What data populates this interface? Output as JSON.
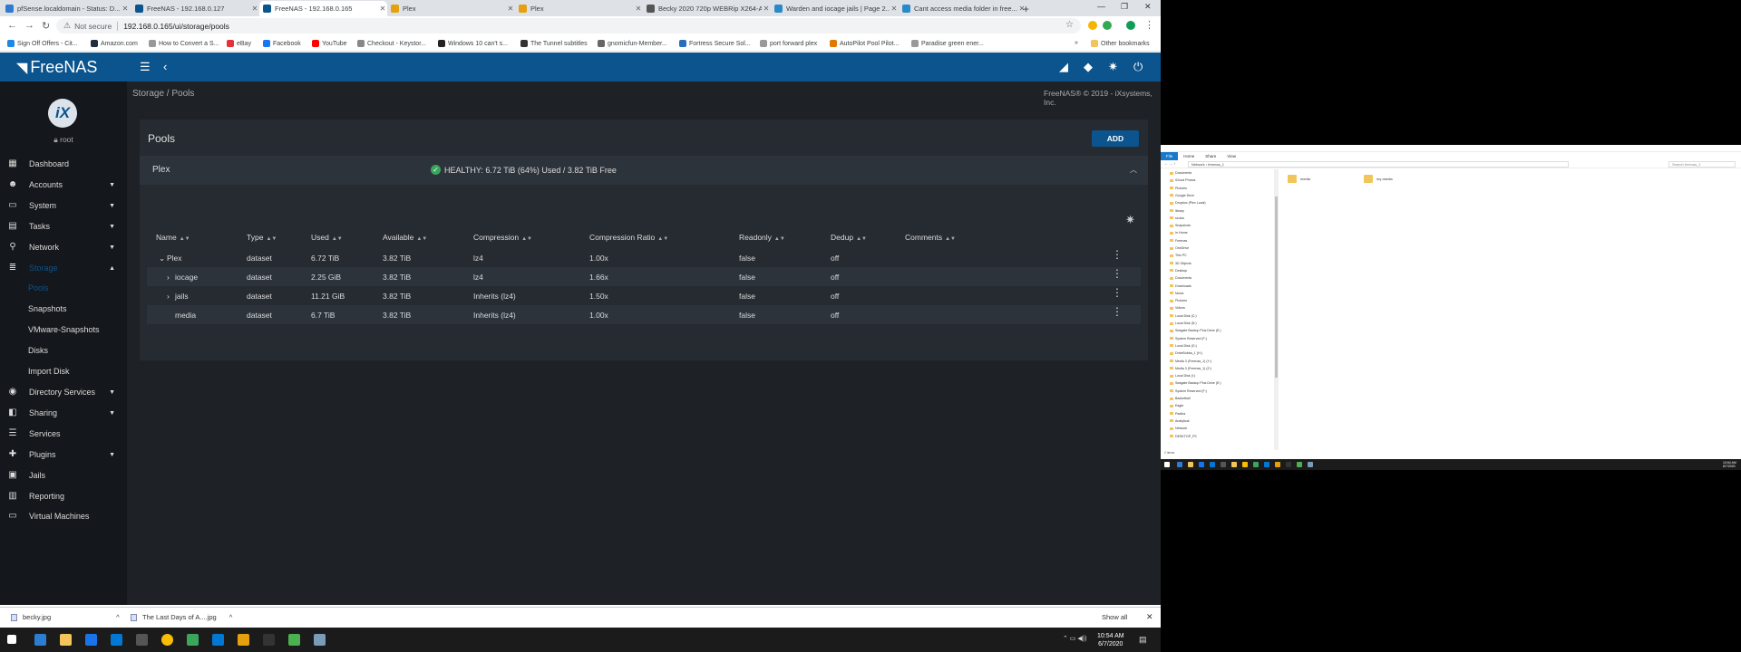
{
  "browser": {
    "tabs": [
      {
        "title": "pfSense.localdomain - Status: D...",
        "fav": "#2e7bcf"
      },
      {
        "title": "FreeNAS - 192.168.0.127",
        "fav": "#0b548e"
      },
      {
        "title": "FreeNAS - 192.168.0.165",
        "fav": "#0b548e"
      },
      {
        "title": "Plex",
        "fav": "#e5a00d"
      },
      {
        "title": "Plex",
        "fav": "#e5a00d"
      },
      {
        "title": "Becky 2020 720p WEBRip X264-A...",
        "fav": "#555"
      },
      {
        "title": "Warden and iocage jails | Page 2...",
        "fav": "#2a8ac8"
      },
      {
        "title": "Cant access media folder in free...",
        "fav": "#2a8ac8"
      }
    ],
    "new_tab": "+",
    "min": "—",
    "max": "❐",
    "close": "✕",
    "back": "←",
    "forward": "→",
    "reload": "↻",
    "security_label": "Not secure",
    "url": "192.168.0.165/ui/storage/pools",
    "bookmarks": [
      "Sign Off Offers - Cit...",
      "Amazon.com",
      "How to Convert a S...",
      "eBay",
      "Facebook",
      "YouTube",
      "Checkout - Keystor...",
      "Windows 10 can't s...",
      "The Tunnel subtitles",
      "gnomicfun-Member...",
      "Fortress Secure Sol...",
      "port forward plex",
      "AutoPilot Pool Pilot...",
      "Paradise green ener..."
    ],
    "more_bookmarks": "»",
    "other_bookmarks": "Other bookmarks"
  },
  "freenas": {
    "logo": "FreeNAS",
    "user": "root",
    "ix": "iX",
    "breadcrumb": "Storage  /  Pools",
    "copyright": "FreeNAS® © 2019 - iXsystems, Inc.",
    "nav": [
      {
        "label": "Dashboard",
        "icon": "▦",
        "arrow": ""
      },
      {
        "label": "Accounts",
        "icon": "☻",
        "arrow": "▼"
      },
      {
        "label": "System",
        "icon": "▭",
        "arrow": "▼"
      },
      {
        "label": "Tasks",
        "icon": "▤",
        "arrow": "▼"
      },
      {
        "label": "Network",
        "icon": "⚲",
        "arrow": "▼"
      },
      {
        "label": "Storage",
        "icon": "≣",
        "arrow": "▲"
      }
    ],
    "subnav": [
      "Pools",
      "Snapshots",
      "VMware-Snapshots",
      "Disks",
      "Import Disk"
    ],
    "nav2": [
      {
        "label": "Directory Services",
        "icon": "◉",
        "arrow": "▼"
      },
      {
        "label": "Sharing",
        "icon": "◧",
        "arrow": "▼"
      },
      {
        "label": "Services",
        "icon": "☰",
        "arrow": ""
      },
      {
        "label": "Plugins",
        "icon": "✚",
        "arrow": "▼"
      },
      {
        "label": "Jails",
        "icon": "▣",
        "arrow": ""
      },
      {
        "label": "Reporting",
        "icon": "▥",
        "arrow": ""
      },
      {
        "label": "Virtual Machines",
        "icon": "▭",
        "arrow": ""
      }
    ],
    "pools": {
      "title": "Pools",
      "add_label": "ADD",
      "pool_name": "Plex",
      "status": "HEALTHY: 6.72 TiB (64%) Used / 3.82 TiB Free",
      "status_color": "#3ba55c",
      "columns": [
        "Name",
        "Type",
        "Used",
        "Available",
        "Compression",
        "Compression Ratio",
        "Readonly",
        "Dedup",
        "Comments"
      ],
      "rows": [
        {
          "expander": "⌄",
          "name": "Plex",
          "type": "dataset",
          "used": "6.72 TiB",
          "avail": "3.82 TiB",
          "comp": "lz4",
          "ratio": "1.00x",
          "ro": "false",
          "dedup": "off"
        },
        {
          "expander": "›",
          "name": "iocage",
          "type": "dataset",
          "used": "2.25 GiB",
          "avail": "3.82 TiB",
          "comp": "lz4",
          "ratio": "1.66x",
          "ro": "false",
          "dedup": "off"
        },
        {
          "expander": "›",
          "name": "jails",
          "type": "dataset",
          "used": "11.21 GiB",
          "avail": "3.82 TiB",
          "comp": "Inherits (lz4)",
          "ratio": "1.50x",
          "ro": "false",
          "dedup": "off"
        },
        {
          "expander": "",
          "name": "media",
          "type": "dataset",
          "used": "6.7 TiB",
          "avail": "3.82 TiB",
          "comp": "Inherits (lz4)",
          "ratio": "1.00x",
          "ro": "false",
          "dedup": "off"
        }
      ]
    },
    "accent": "#0b548e"
  },
  "downloads": {
    "items": [
      "becky.jpg",
      "The Last Days of A....jpg"
    ],
    "show_all": "Show all"
  },
  "taskbar": {
    "time": "10:54 AM",
    "date": "6/7/2020"
  },
  "explorer": {
    "ribbon": [
      "File",
      "Home",
      "Share",
      "View"
    ],
    "path": "Network › freenas_1",
    "search_placeholder": "Search freenas_1",
    "tree": [
      "Documents",
      "iCloud Photos",
      "Pictures",
      "Google Drive",
      "Dropbox (Plex Local)",
      "library",
      "scuba",
      "Snapshots",
      "In Home",
      "Freenas",
      "OneDrive",
      "This PC",
      "3D Objects",
      "Desktop",
      "Documents",
      "Downloads",
      "Music",
      "Pictures",
      "Videos",
      "Local Disk (C:)",
      "Local Disk (D:)",
      "Seagate Backup Plus Drive (E:)",
      "System Reserved (F:)",
      "Local Disk (G:)",
      "DriveBubba_1 (H:)",
      "Media 3 (Freenas_1) (Y:)",
      "Media 3 (Freenas_1) (Z:)",
      "Local Disk (I:)",
      "Seagate Backup Plus Drive (E:)",
      "System Reserved (F:)",
      "Basketball",
      "Eagle",
      "Padiha",
      "Analytical",
      "Network",
      "DESKTOP_PC"
    ],
    "items": [
      "media",
      "my-media"
    ],
    "status": "2 items",
    "time": "10:54 AM",
    "date": "6/7/2020"
  }
}
